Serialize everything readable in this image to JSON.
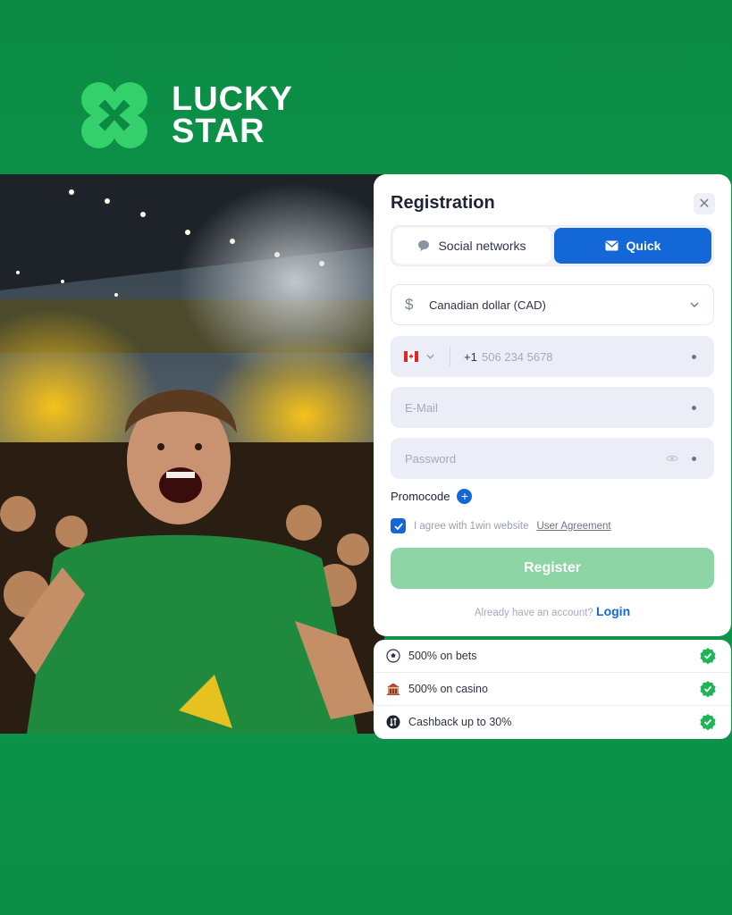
{
  "brand": {
    "line1": "LUCKY",
    "line2": "STAR"
  },
  "registration": {
    "title": "Registration",
    "tabs": [
      {
        "label": "Social networks",
        "active": false
      },
      {
        "label": "Quick",
        "active": true
      }
    ],
    "currency": {
      "value": "Canadian dollar (CAD)",
      "symbol": "$"
    },
    "phone": {
      "country_code": "+1",
      "placeholder": "506 234 5678"
    },
    "email": {
      "placeholder": "E-Mail"
    },
    "password": {
      "placeholder": "Password"
    },
    "promocode_label": "Promocode",
    "agreement": {
      "text": "I agree with 1win website",
      "link": "User Agreement",
      "checked": true
    },
    "register_label": "Register",
    "already_text": "Already have an account?",
    "login_label": "Login"
  },
  "bonuses": [
    {
      "icon": "soccer-ball-icon",
      "label": "500% on bets"
    },
    {
      "icon": "casino-icon",
      "label": "500% on casino"
    },
    {
      "icon": "cashback-icon",
      "label": "Cashback up to 30%"
    }
  ],
  "colors": {
    "background": "#0e9a4c",
    "accent": "#1467d6",
    "register": "#8ed5a5",
    "logo_mark": "#34d06b",
    "check": "#1fb457"
  }
}
